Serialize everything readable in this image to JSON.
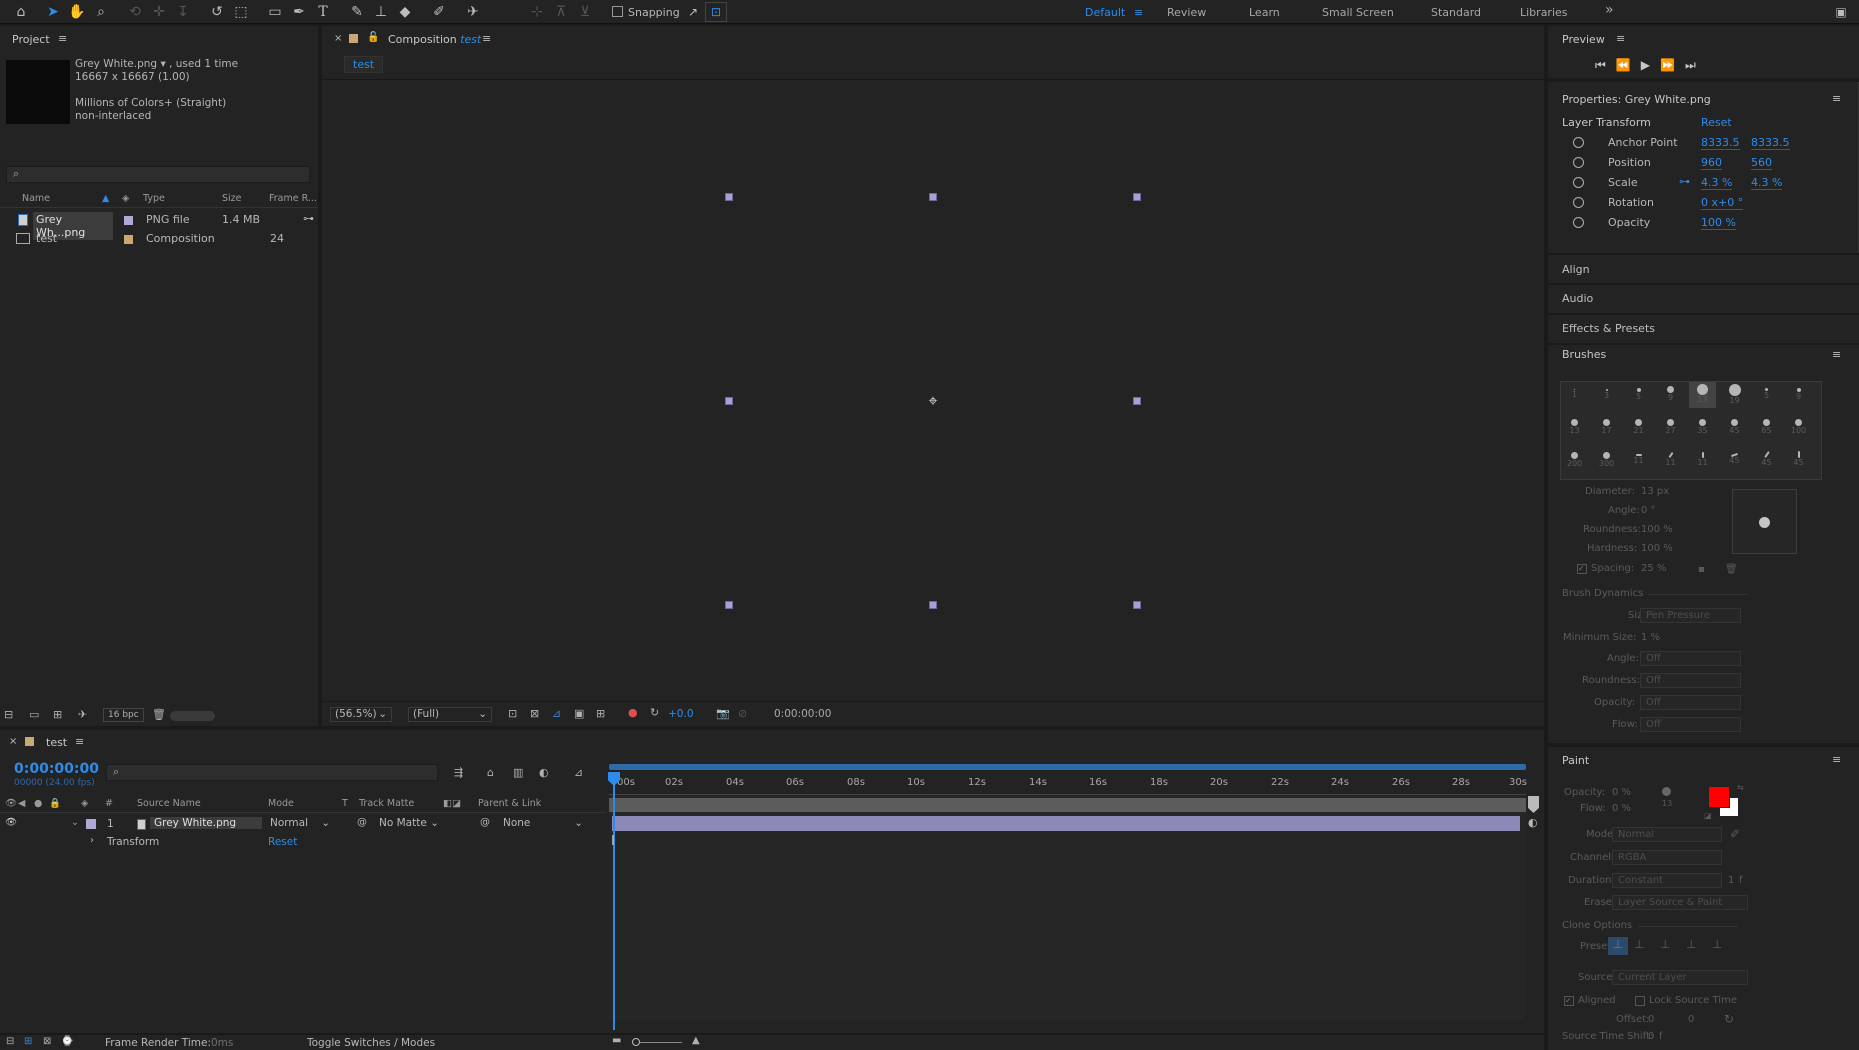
{
  "toolbar": {
    "snapping_label": "Snapping",
    "workspaces": [
      "Default",
      "Review",
      "Learn",
      "Small Screen",
      "Standard",
      "Libraries"
    ],
    "overflow": "»"
  },
  "project": {
    "title": "Project",
    "item_name": "Grey White.png",
    "used_text": ", used 1 time",
    "dimensions": "16667 x 16667 (1.00)",
    "colors": "Millions of Colors+ (Straight)",
    "interlace": "non-interlaced",
    "columns": [
      "Name",
      "Type",
      "Size",
      "Frame R..."
    ],
    "items": [
      {
        "name": "Grey Wh...png",
        "type": "PNG file",
        "size": "1.4 MB",
        "frame_rate": ""
      },
      {
        "name": "test",
        "type": "Composition",
        "size": "",
        "frame_rate": "24"
      }
    ],
    "bpc": "16 bpc"
  },
  "composition": {
    "tab_prefix": "Composition",
    "tab_name": "test",
    "subtab": "test",
    "zoom": "(56.5%)",
    "resolution": "(Full)",
    "exposure": "+0.0",
    "timecode": "0:00:00:00"
  },
  "preview": {
    "title": "Preview"
  },
  "properties": {
    "title": "Properties: Grey White.png",
    "section": "Layer Transform",
    "reset": "Reset",
    "rows": [
      {
        "label": "Anchor Point",
        "v1": "8333.5",
        "v2": "8333.5"
      },
      {
        "label": "Position",
        "v1": "960",
        "v2": "560"
      },
      {
        "label": "Scale",
        "v1": "4.3 %",
        "v2": "4.3 %"
      },
      {
        "label": "Rotation",
        "v1": "0 x+0 °",
        "v2": ""
      },
      {
        "label": "Opacity",
        "v1": "100 %",
        "v2": ""
      }
    ]
  },
  "collapsed_panels": [
    "Align",
    "Audio",
    "Effects & Presets"
  ],
  "brushes": {
    "title": "Brushes",
    "sizes": [
      [
        "1",
        "3",
        "5",
        "9",
        "13",
        "19",
        "5",
        "9"
      ],
      [
        "13",
        "17",
        "21",
        "27",
        "35",
        "45",
        "65",
        "100"
      ],
      [
        "200",
        "300",
        "11",
        "11",
        "11",
        "45",
        "45",
        "45"
      ]
    ],
    "diameter_label": "Diameter:",
    "diameter": "13 px",
    "angle_label": "Angle:",
    "angle": "0 °",
    "roundness_label": "Roundness:",
    "roundness": "100 %",
    "hardness_label": "Hardness:",
    "hardness": "100 %",
    "spacing_label": "Spacing:",
    "spacing": "25 %",
    "dynamics_label": "Brush Dynamics",
    "dyn_rows": [
      {
        "label": "Size:",
        "value": "Pen Pressure"
      },
      {
        "label": "Minimum Size:",
        "value": "1 %"
      },
      {
        "label": "Angle:",
        "value": "Off"
      },
      {
        "label": "Roundness:",
        "value": "Off"
      },
      {
        "label": "Opacity:",
        "value": "Off"
      },
      {
        "label": "Flow:",
        "value": "Off"
      }
    ]
  },
  "paint": {
    "title": "Paint",
    "opacity_label": "Opacity:",
    "opacity": "0 %",
    "flow_label": "Flow:",
    "flow": "0 %",
    "brush_size": "13",
    "mode_label": "Mode:",
    "mode": "Normal",
    "channels_label": "Channels:",
    "channels": "RGBA",
    "duration_label": "Duration:",
    "duration": "Constant",
    "duration_val": "1",
    "duration_unit": "f",
    "erase_label": "Erase:",
    "erase": "Layer Source & Paint",
    "clone_label": "Clone Options",
    "preset_label": "Preset:",
    "source_label": "Source:",
    "source": "Current Layer",
    "aligned_label": "Aligned",
    "lock_label": "Lock Source Time",
    "offset_label": "Offset:",
    "offset_x": "0",
    "offset_y": "0",
    "time_shift_label": "Source Time Shift:",
    "time_shift": "0",
    "time_shift_unit": "f",
    "fg_color": "#ff0000",
    "bg_color": "#ffffff"
  },
  "timeline": {
    "tab": "test",
    "timecode": "0:00:00:00",
    "frame_info": "00000 (24.00 fps)",
    "columns": [
      "#",
      "Source Name",
      "Mode",
      "T",
      "Track Matte",
      "Parent & Link"
    ],
    "layer": {
      "index": "1",
      "name": "Grey White.png",
      "mode": "Normal",
      "matte": "No Matte",
      "parent": "None"
    },
    "transform_label": "Transform",
    "transform_reset": "Reset",
    "ruler": [
      "00s",
      "02s",
      "04s",
      "06s",
      "08s",
      "10s",
      "12s",
      "14s",
      "16s",
      "18s",
      "20s",
      "22s",
      "24s",
      "26s",
      "28s",
      "30s"
    ],
    "render_time_label": "Frame Render Time:",
    "render_time": "0ms",
    "toggle_label": "Toggle Switches / Modes"
  }
}
